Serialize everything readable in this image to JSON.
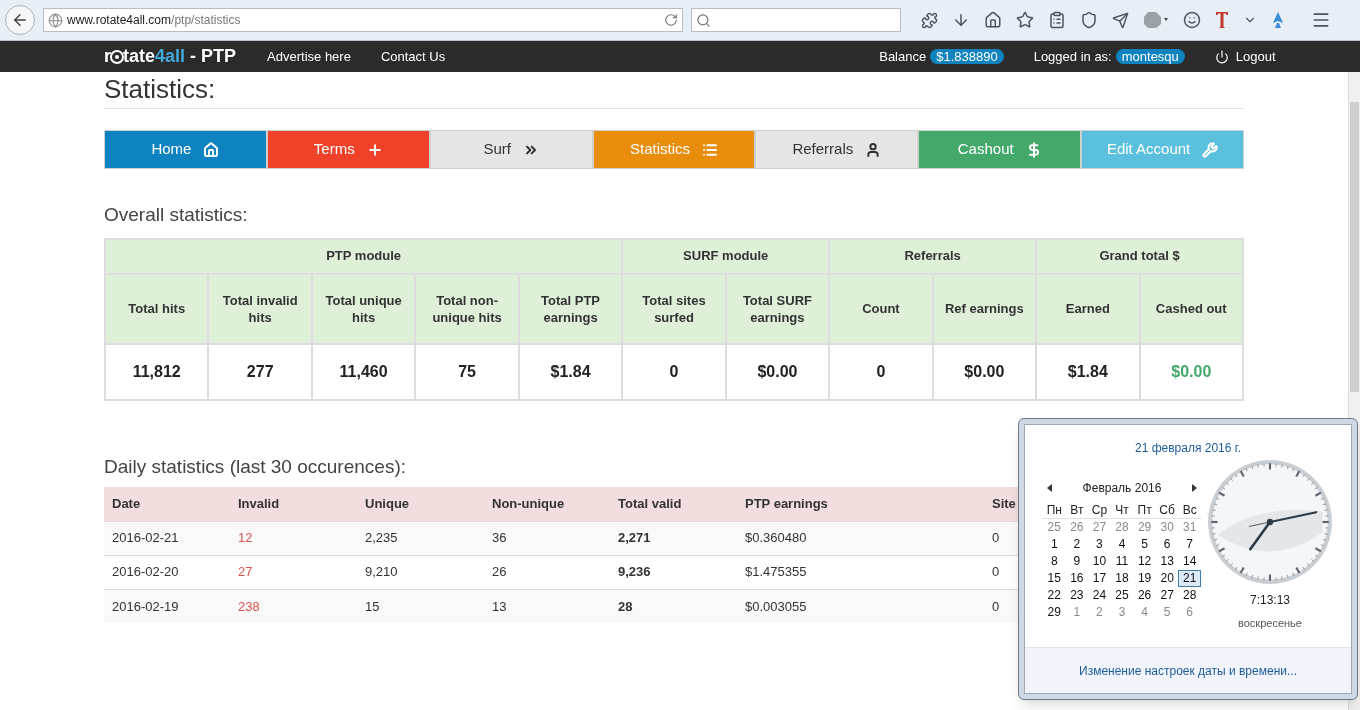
{
  "browser": {
    "url_host": "www.rotate4all.com",
    "url_path": "/ptp/statistics"
  },
  "navbar": {
    "brand": {
      "part1": "r",
      "part2": "tate",
      "part3": "4all",
      "part4": " - PTP"
    },
    "links": [
      "Advertise here",
      "Contact Us"
    ],
    "balance_label": "Balance",
    "balance": "$1.838890",
    "logged_label": "Logged in as:",
    "user": "montesqu",
    "logout": "Logout"
  },
  "page_title": "Statistics:",
  "menu": [
    {
      "label": "Home",
      "kind": "dark",
      "color": "#0e83c0"
    },
    {
      "label": "Terms",
      "kind": "dark",
      "color": "#f0422a"
    },
    {
      "label": "Surf",
      "kind": "light",
      "color": "#e6e6e6"
    },
    {
      "label": "Statistics",
      "kind": "dark",
      "color": "#e88d0c"
    },
    {
      "label": "Referrals",
      "kind": "light",
      "color": "#e6e6e6"
    },
    {
      "label": "Cashout",
      "kind": "dark",
      "color": "#43a869"
    },
    {
      "label": "Edit Account",
      "kind": "dark",
      "color": "#5bc0de"
    }
  ],
  "overall": {
    "title": "Overall statistics:",
    "groups": [
      "PTP module",
      "SURF module",
      "Referrals",
      "Grand total $"
    ],
    "columns": [
      "Total hits",
      "Total invalid hits",
      "Total unique hits",
      "Total non-unique hits",
      "Total PTP earnings",
      "Total sites surfed",
      "Total SURF earnings",
      "Count",
      "Ref earnings",
      "Earned",
      "Cashed out"
    ],
    "values": [
      {
        "text": "11,812",
        "color": "#222222"
      },
      {
        "text": "277",
        "color": "#222222"
      },
      {
        "text": "11,460",
        "color": "#222222"
      },
      {
        "text": "75",
        "color": "#222222"
      },
      {
        "text": "$1.84",
        "color": "#222222"
      },
      {
        "text": "0",
        "color": "#222222"
      },
      {
        "text": "$0.00",
        "color": "#222222"
      },
      {
        "text": "0",
        "color": "#222222"
      },
      {
        "text": "$0.00",
        "color": "#222222"
      },
      {
        "text": "$1.84",
        "color": "#222222"
      },
      {
        "text": "$0.00",
        "color": "#43a869"
      }
    ]
  },
  "daily": {
    "title": "Daily statistics (last 30 occurences):",
    "columns": [
      "Date",
      "Invalid",
      "Unique",
      "Non-unique",
      "Total valid",
      "PTP earnings",
      "Site"
    ],
    "rows": [
      [
        "2016-02-21",
        "12",
        "2,235",
        "36",
        "2,271",
        "$0.360480",
        "0"
      ],
      [
        "2016-02-20",
        "27",
        "9,210",
        "26",
        "9,236",
        "$1.475355",
        "0"
      ],
      [
        "2016-02-19",
        "238",
        "15",
        "13",
        "28",
        "$0.003055",
        "0"
      ]
    ]
  },
  "calendar_popup": {
    "date_title": "21 февраля 2016 г.",
    "month": "Февраль 2016",
    "weekdays": [
      "Пн",
      "Вт",
      "Ср",
      "Чт",
      "Пт",
      "Сб",
      "Вс"
    ],
    "days": [
      {
        "d": "25",
        "muted": true,
        "selected": false
      },
      {
        "d": "26",
        "muted": true,
        "selected": false
      },
      {
        "d": "27",
        "muted": true,
        "selected": false
      },
      {
        "d": "28",
        "muted": true,
        "selected": false
      },
      {
        "d": "29",
        "muted": true,
        "selected": false
      },
      {
        "d": "30",
        "muted": true,
        "selected": false
      },
      {
        "d": "31",
        "muted": true,
        "selected": false
      },
      {
        "d": "1",
        "muted": false,
        "selected": false
      },
      {
        "d": "2",
        "muted": false,
        "selected": false
      },
      {
        "d": "3",
        "muted": false,
        "selected": false
      },
      {
        "d": "4",
        "muted": false,
        "selected": false
      },
      {
        "d": "5",
        "muted": false,
        "selected": false
      },
      {
        "d": "6",
        "muted": false,
        "selected": false
      },
      {
        "d": "7",
        "muted": false,
        "selected": false
      },
      {
        "d": "8",
        "muted": false,
        "selected": false
      },
      {
        "d": "9",
        "muted": false,
        "selected": false
      },
      {
        "d": "10",
        "muted": false,
        "selected": false
      },
      {
        "d": "11",
        "muted": false,
        "selected": false
      },
      {
        "d": "12",
        "muted": false,
        "selected": false
      },
      {
        "d": "13",
        "muted": false,
        "selected": false
      },
      {
        "d": "14",
        "muted": false,
        "selected": false
      },
      {
        "d": "15",
        "muted": false,
        "selected": false
      },
      {
        "d": "16",
        "muted": false,
        "selected": false
      },
      {
        "d": "17",
        "muted": false,
        "selected": false
      },
      {
        "d": "18",
        "muted": false,
        "selected": false
      },
      {
        "d": "19",
        "muted": false,
        "selected": false
      },
      {
        "d": "20",
        "muted": false,
        "selected": false
      },
      {
        "d": "21",
        "muted": false,
        "selected": true
      },
      {
        "d": "22",
        "muted": false,
        "selected": false
      },
      {
        "d": "23",
        "muted": false,
        "selected": false
      },
      {
        "d": "24",
        "muted": false,
        "selected": false
      },
      {
        "d": "25",
        "muted": false,
        "selected": false
      },
      {
        "d": "26",
        "muted": false,
        "selected": false
      },
      {
        "d": "27",
        "muted": false,
        "selected": false
      },
      {
        "d": "28",
        "muted": false,
        "selected": false
      },
      {
        "d": "29",
        "muted": false,
        "selected": false
      },
      {
        "d": "1",
        "muted": true,
        "selected": false
      },
      {
        "d": "2",
        "muted": true,
        "selected": false
      },
      {
        "d": "3",
        "muted": true,
        "selected": false
      },
      {
        "d": "4",
        "muted": true,
        "selected": false
      },
      {
        "d": "5",
        "muted": true,
        "selected": false
      },
      {
        "d": "6",
        "muted": true,
        "selected": false
      }
    ],
    "time": "7:13:13",
    "weekday": "воскресенье",
    "settings_link": "Изменение настроек даты и времени..."
  }
}
